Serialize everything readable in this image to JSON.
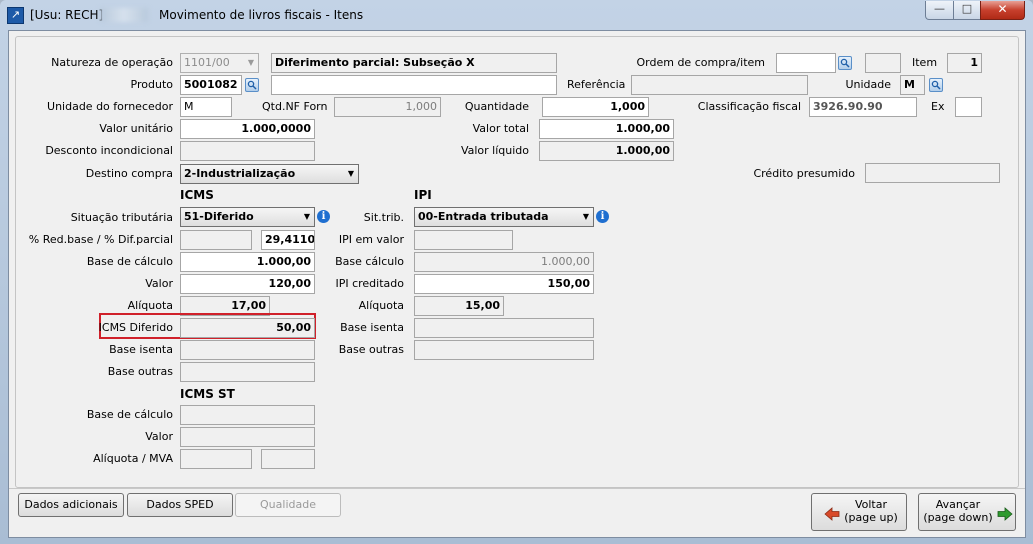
{
  "window": {
    "user_label": "[Usu: RECH]",
    "title": "Movimento de livros fiscais - Itens",
    "minimize": "—",
    "maximize": "□",
    "close": "✕"
  },
  "header": {
    "natureza_label": "Natureza de operação",
    "natureza_value": "1101/00",
    "natureza_desc": "Diferimento parcial: Subseção X",
    "ordem_label": "Ordem de compra/item",
    "ordem_value": "",
    "ordem_item_value": "",
    "item_label": "Item",
    "item_value": "1",
    "produto_label": "Produto",
    "produto_value": "5001082",
    "produto_desc": "",
    "referencia_label": "Referência",
    "referencia_value": "",
    "unidade_label": "Unidade",
    "unidade_value": "M",
    "unidade_forn_label": "Unidade do fornecedor",
    "unidade_forn_value": "M",
    "qtd_nf_forn_label": "Qtd.NF Forn",
    "qtd_nf_forn_value": "1,000",
    "quantidade_label": "Quantidade",
    "quantidade_value": "1,000",
    "classificacao_label": "Classificação fiscal",
    "classificacao_value": "3926.90.90",
    "ex_label": "Ex",
    "ex_value": "",
    "valor_unitario_label": "Valor unitário",
    "valor_unitario_value": "1.000,0000",
    "valor_total_label": "Valor total",
    "valor_total_value": "1.000,00",
    "desconto_label": "Desconto incondicional",
    "desconto_value": "",
    "valor_liquido_label": "Valor líquido",
    "valor_liquido_value": "1.000,00",
    "destino_label": "Destino compra",
    "destino_value": "2-Industrialização",
    "credito_label": "Crédito presumido",
    "credito_value": ""
  },
  "icms": {
    "title": "ICMS",
    "situacao_label": "Situação tributária",
    "situacao_value": "51-Diferido",
    "red_base_label": "% Red.base / % Dif.parcial",
    "red_base_value": "",
    "dif_parcial_value": "29,4110",
    "base_calculo_label": "Base de cálculo",
    "base_calculo_value": "1.000,00",
    "valor_label": "Valor",
    "valor_value": "120,00",
    "aliquota_label": "Alíquota",
    "aliquota_value": "17,00",
    "diferido_label": "ICMS Diferido",
    "diferido_value": "50,00",
    "base_isenta_label": "Base isenta",
    "base_isenta_value": "",
    "base_outras_label": "Base outras",
    "base_outras_value": ""
  },
  "ipi": {
    "title": "IPI",
    "sit_trib_label": "Sit.trib.",
    "sit_trib_value": "00-Entrada tributada",
    "ipi_valor_label": "IPI em valor",
    "ipi_valor_value": "",
    "base_calculo_label": "Base cálculo",
    "base_calculo_value": "1.000,00",
    "ipi_creditado_label": "IPI creditado",
    "ipi_creditado_value": "150,00",
    "aliquota_label": "Alíquota",
    "aliquota_value": "15,00",
    "base_isenta_label": "Base isenta",
    "base_isenta_value": "",
    "base_outras_label": "Base outras",
    "base_outras_value": ""
  },
  "icms_st": {
    "title": "ICMS ST",
    "base_calculo_label": "Base de cálculo",
    "base_calculo_value": "",
    "valor_label": "Valor",
    "valor_value": "",
    "aliquota_mva_label": "Alíquota / MVA",
    "aliquota_value": "",
    "mva_value": ""
  },
  "footer": {
    "dados_adicionais": "Dados adicionais",
    "dados_sped": "Dados SPED",
    "qualidade": "Qualidade",
    "voltar_line1": "Voltar",
    "voltar_line2": "(page up)",
    "avancar_line1": "Avançar",
    "avancar_line2": "(page down)"
  },
  "colors": {
    "highlight_box": "#d0202a",
    "info_icon": "#1f6fd0",
    "voltar_arrow": "#d84a2a",
    "avancar_arrow": "#2e9a2e"
  }
}
